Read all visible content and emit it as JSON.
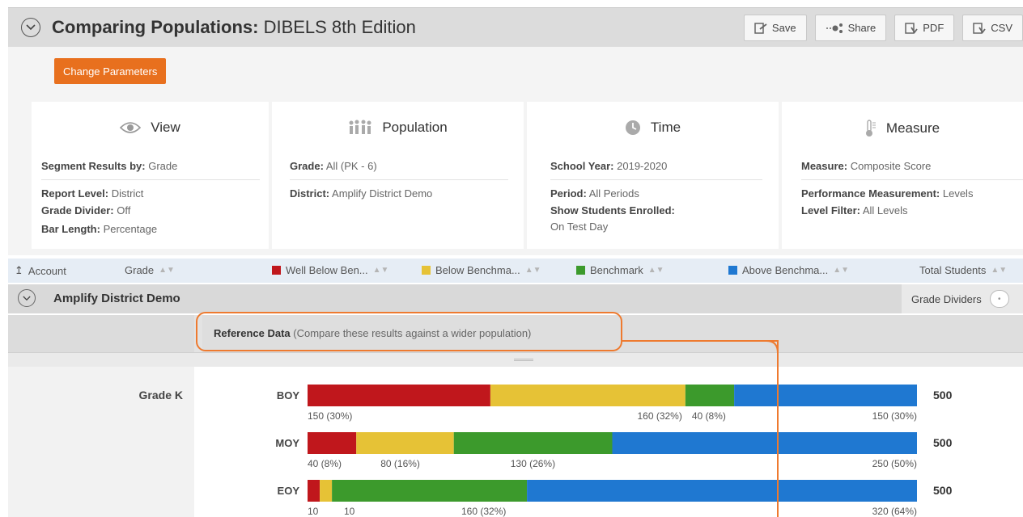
{
  "header": {
    "title_bold": "Comparing Populations:",
    "title_rest": " DIBELS 8th Edition",
    "toolbar": [
      {
        "label": "Save",
        "icon": "save-icon"
      },
      {
        "label": "Share",
        "icon": "share-icon"
      },
      {
        "label": "PDF",
        "icon": "pdf-icon"
      },
      {
        "label": "CSV",
        "icon": "csv-icon"
      }
    ]
  },
  "change_parameters_label": "Change Parameters",
  "panels": {
    "view": {
      "title": "View",
      "segment_label": "Segment Results by:",
      "segment_value": "Grade",
      "report_label": "Report Level:",
      "report_value": "District",
      "divider_label": "Grade Divider:",
      "divider_value": "Off",
      "bar_label": "Bar Length:",
      "bar_value": "Percentage"
    },
    "population": {
      "title": "Population",
      "grade_label": "Grade:",
      "grade_value": "All (PK - 6)",
      "district_label": "District:",
      "district_value": "Amplify District Demo"
    },
    "time": {
      "title": "Time",
      "year_label": "School Year:",
      "year_value": "2019-2020",
      "period_label": "Period:",
      "period_value": "All Periods",
      "enrolled_label": "Show Students Enrolled:",
      "enrolled_value": "On Test Day"
    },
    "measure": {
      "title": "Measure",
      "measure_label": "Measure:",
      "measure_value": "Composite Score",
      "perf_label": "Performance Measurement:",
      "perf_value": "Levels",
      "filter_label": "Level Filter:",
      "filter_value": "All Levels"
    }
  },
  "columns": {
    "account": "Account",
    "grade": "Grade",
    "well_below": "Well Below Ben...",
    "below": "Below Benchma...",
    "benchmark": "Benchmark",
    "above": "Above Benchma...",
    "total": "Total Students"
  },
  "colors": {
    "well_below": "#c0171c",
    "below": "#e6c236",
    "benchmark": "#3c9a2c",
    "above": "#1f78d1",
    "accent": "#e8701e"
  },
  "group": {
    "name": "Amplify District Demo",
    "grade_dividers_label": "Grade Dividers"
  },
  "reference": {
    "label": "Reference Data",
    "note": "(Compare these results against a wider population)"
  },
  "chart_data": {
    "type": "bar",
    "stacked": true,
    "orientation": "horizontal",
    "group_label": "Grade K",
    "series_names": [
      "Well Below Benchmark",
      "Below Benchmark",
      "Benchmark",
      "Above Benchmark"
    ],
    "rows": [
      {
        "period": "BOY",
        "total": "500",
        "values": [
          150,
          160,
          40,
          150
        ],
        "labels": [
          "150 (30%)",
          "160 (32%)",
          "40 (8%)",
          "150 (30%)"
        ]
      },
      {
        "period": "MOY",
        "total": "500",
        "values": [
          40,
          80,
          130,
          250
        ],
        "labels": [
          "40 (8%)",
          "80 (16%)",
          "130 (26%)",
          "250 (50%)"
        ]
      },
      {
        "period": "EOY",
        "total": "500",
        "values": [
          10,
          10,
          160,
          320
        ],
        "labels": [
          "10",
          "10",
          "160 (32%)",
          "320 (64%)"
        ]
      }
    ]
  }
}
